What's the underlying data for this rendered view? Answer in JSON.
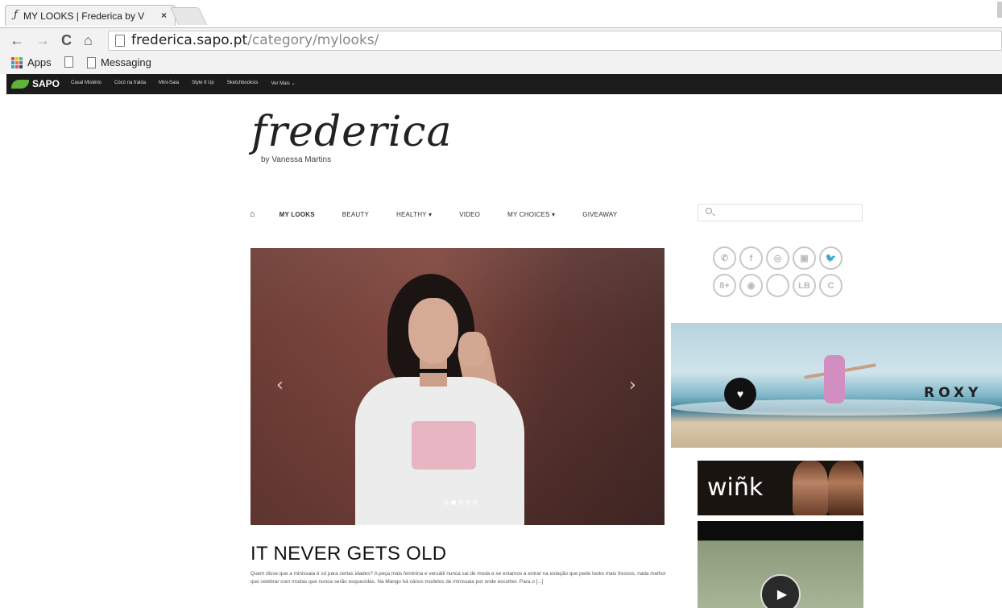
{
  "browser": {
    "tab_title": "MY LOOKS | Frederica by V",
    "tab_close": "×",
    "url_host": "frederica.sapo.pt",
    "url_path": "/category/mylooks/",
    "nav": {
      "back": "←",
      "forward": "→",
      "reload": "C",
      "home": "⌂"
    }
  },
  "bookmarks": [
    {
      "label": "Apps",
      "icon": "apps-grid-icon"
    },
    {
      "label": "",
      "icon": "page-icon"
    },
    {
      "label": "Messaging",
      "icon": "page-icon"
    }
  ],
  "sapo_bar": {
    "brand": "SAPO",
    "links": [
      "Casal Mistério",
      "Cócó na fralda",
      "Mini-Saia",
      "Style It Up",
      "Sketchbooksis",
      "Ver Mais ⌄"
    ]
  },
  "site": {
    "logo_script": "frederica",
    "logo_sub": "by Vanessa Martins"
  },
  "main_nav": {
    "home_icon": "home-icon",
    "items": [
      {
        "label": "MY LOOKS",
        "active": true
      },
      {
        "label": "BEAUTY",
        "active": false
      },
      {
        "label": "HEALTHY ▾",
        "active": false
      },
      {
        "label": "VIDEO",
        "active": false
      },
      {
        "label": "MY CHOICES ▾",
        "active": false
      },
      {
        "label": "GIVEAWAY",
        "active": false
      }
    ]
  },
  "search": {
    "placeholder": ""
  },
  "social": {
    "row1": [
      "✆",
      "f",
      "◎",
      "▣",
      "🐦"
    ],
    "row2": [
      "8+",
      "◉",
      "",
      "LB",
      "C"
    ]
  },
  "slider": {
    "prev": "‹",
    "next": "›",
    "dots": 5,
    "active_dot": 1
  },
  "post": {
    "title": "IT NEVER GETS OLD",
    "excerpt": "Quem disse que a minissaia é só para certas idades? A peça mais feminina e versátil nunca sai de moda e se estamos a entrar na estação que pede looks mais frescos, nada melhor que celebrar com modas que nunca serão esquecidas. Na Mango há vários modelos de minissaia por onde escolher. Para o [...]"
  },
  "ads": {
    "roxy_brand": "ROXY",
    "wink_brand": "wiñk",
    "video_play": "▶"
  }
}
